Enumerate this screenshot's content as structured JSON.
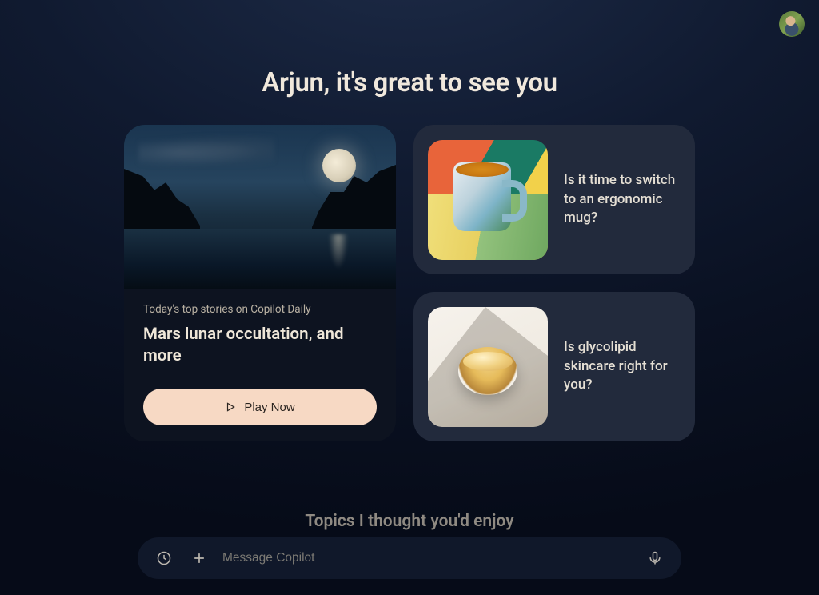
{
  "header": {
    "avatar_alt": "user-avatar"
  },
  "greeting": "Arjun, it's great to see you",
  "daily": {
    "kicker": "Today's top stories on Copilot Daily",
    "headline": "Mars lunar occultation, and more",
    "play_label": "Play Now"
  },
  "suggestions": [
    {
      "text": "Is it time to switch to an ergonomic mug?"
    },
    {
      "text": "Is glycolipid skincare right for you?"
    }
  ],
  "topics_title": "Topics I thought you'd enjoy",
  "composer": {
    "placeholder": "Message Copilot",
    "value": ""
  }
}
